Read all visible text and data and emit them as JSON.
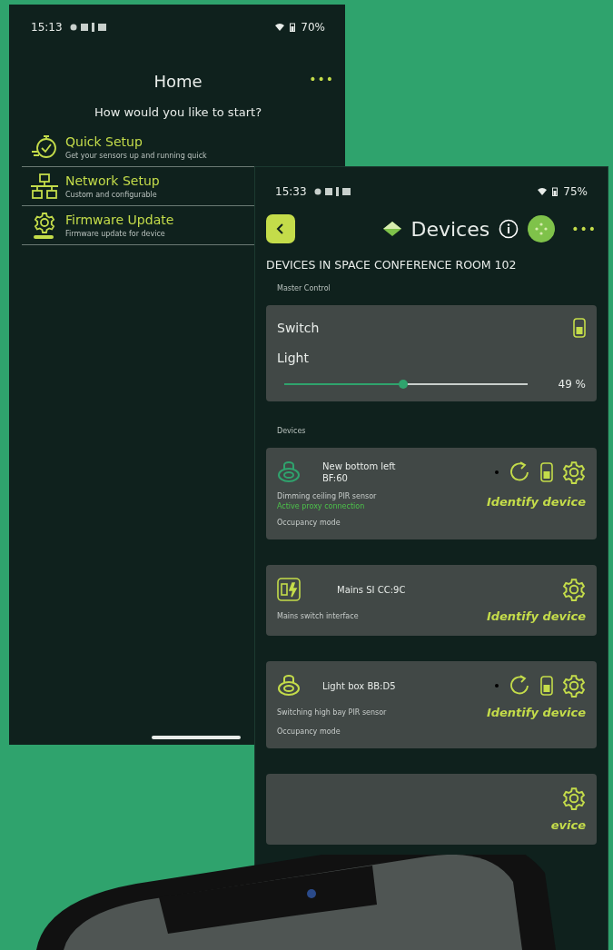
{
  "home_screen": {
    "status_bar": {
      "time": "15:13",
      "battery": "70%"
    },
    "title": "Home",
    "more": "•••",
    "prompt": "How would you like to start?",
    "options": [
      {
        "kind": "quick",
        "title": "Quick Setup",
        "subtitle": "Get your sensors up and running quick"
      },
      {
        "kind": "network",
        "title": "Network Setup",
        "subtitle": "Custom and configurable"
      },
      {
        "kind": "firmware",
        "title": "Firmware Update",
        "subtitle": "Firmware update for device"
      }
    ]
  },
  "devices_screen": {
    "status_bar": {
      "time": "15:33",
      "battery": "75%"
    },
    "title": "Devices",
    "more": "•••",
    "heading": "DEVICES IN SPACE CONFERENCE ROOM 102",
    "master_label": "Master Control",
    "master": {
      "switch_label": "Switch",
      "light_label": "Light",
      "level": 0.49,
      "reading": "49 %"
    },
    "devices_label": "Devices",
    "devices": [
      {
        "kind": "sensor",
        "name": "New bottom left",
        "address": "BF:60",
        "description": "Dimming ceiling PIR sensor",
        "status": "Active proxy connection",
        "mode": "Occupancy mode",
        "action": "Identify device"
      },
      {
        "kind": "interface",
        "name": "Mains SI CC:9C",
        "description": "Mains switch interface",
        "action": "Identify device"
      },
      {
        "kind": "sensor",
        "name": "Light box BB:D5",
        "description": "Switching high bay PIR sensor",
        "mode": "Occupancy mode",
        "action": "Identify device"
      },
      {
        "kind": "partial",
        "action": "evice"
      }
    ]
  }
}
